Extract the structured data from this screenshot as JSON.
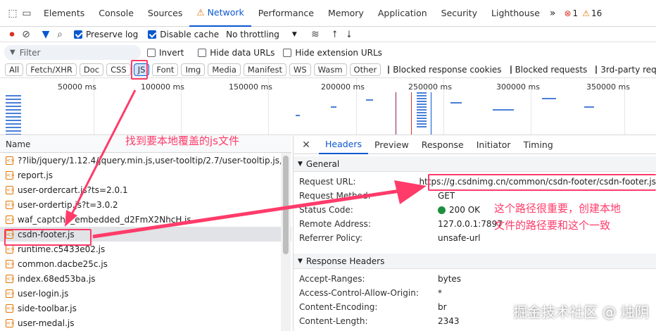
{
  "tabs": [
    "Elements",
    "Console",
    "Sources",
    "Network",
    "Performance",
    "Memory",
    "Application",
    "Security",
    "Lighthouse"
  ],
  "more": "»",
  "errors": "1",
  "warnings": "16",
  "toolbar": {
    "preserve_log": "Preserve log",
    "disable_cache": "Disable cache",
    "throttle": "No throttling"
  },
  "filter": {
    "placeholder": "Filter",
    "invert": "Invert",
    "hide_data": "Hide data URLs",
    "hide_ext": "Hide extension URLs"
  },
  "types": [
    "All",
    "Fetch/XHR",
    "Doc",
    "CSS",
    "JS",
    "Font",
    "Img",
    "Media",
    "Manifest",
    "WS",
    "Wasm",
    "Other"
  ],
  "blocked_cookies": "Blocked response cookies",
  "blocked_requests": "Blocked requests",
  "third_party": "3rd-party req",
  "ticks": [
    "50000 ms",
    "100000 ms",
    "150000 ms",
    "200000 ms",
    "250000 ms",
    "300000 ms",
    "350000 ms"
  ],
  "name_header": "Name",
  "files": [
    "??lib/jquery/1.12.4/jquery.min.js,user-tooltip/2.7/user-tooltip.js,...",
    "report.js",
    "user-ordercart.js?ts=2.0.1",
    "user-ordertip.js?t=3.0.2",
    "waf_captcha_embedded_d2FmX2NhcH.js",
    "csdn-footer.js",
    "runtime.c5433e02.js",
    "common.dacbe25c.js",
    "index.68ed53ba.js",
    "user-login.js",
    "side-toolbar.js",
    "user-medal.js"
  ],
  "rtabs": [
    "Headers",
    "Preview",
    "Response",
    "Initiator",
    "Timing"
  ],
  "general": {
    "title": "General",
    "rows": [
      [
        "Request URL:",
        "https://g.csdnimg.cn/common/csdn-footer/csdn-footer.js"
      ],
      [
        "Request Method:",
        "GET"
      ],
      [
        "Status Code:",
        "200 OK"
      ],
      [
        "Remote Address:",
        "127.0.0.1:7897"
      ],
      [
        "Referrer Policy:",
        "unsafe-url"
      ]
    ]
  },
  "response": {
    "title": "Response Headers",
    "rows": [
      [
        "Accept-Ranges:",
        "bytes"
      ],
      [
        "Access-Control-Allow-Origin:",
        "*"
      ],
      [
        "Content-Encoding:",
        "br"
      ],
      [
        "Content-Length:",
        "2343"
      ]
    ]
  },
  "anno1": "找到要本地覆盖的js文件",
  "anno2a": "这个路径很重要，创建本地",
  "anno2b": "文件的路径要和这个一致",
  "watermark": "掘金技术社区 @ 烛阴",
  "colors": {
    "accent": "#0b57d0",
    "annotation": "#ff3b6a",
    "js_icon": "#e37400",
    "ok": "#1e8e3e",
    "error": "#d93025",
    "warning": "#e37400"
  }
}
